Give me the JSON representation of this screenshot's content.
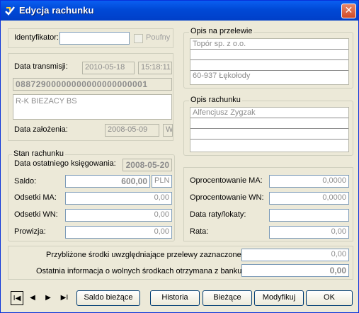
{
  "window": {
    "title": "Edycja rachunku",
    "close": "✕"
  },
  "ident": {
    "label": "Identyfikator:",
    "value": "",
    "confidential_label": "Poufny",
    "confidential_checked": false
  },
  "transmission": {
    "date_label": "Data transmisji:",
    "date": "2010-05-18",
    "time": "15:18:11",
    "account_number": "08872900000000000000000001",
    "account_name": "R-K BIEZACY  BS",
    "created_label": "Data założenia:",
    "created_date": "2008-05-09",
    "created_code": "W"
  },
  "transfer_desc": {
    "legend": "Opis na przelewie",
    "lines": [
      "Topór sp. z o.o.",
      "",
      "",
      "60-937 Łękołody"
    ]
  },
  "account_desc": {
    "legend": "Opis rachunku",
    "lines": [
      "Alfencjusz Zygzak",
      "",
      "",
      ""
    ]
  },
  "status": {
    "legend": "Stan rachunku",
    "last_posting_label": "Data ostatniego księgowania:",
    "last_posting_date": "2008-05-20",
    "balance_label": "Saldo:",
    "balance": "600,00",
    "currency": "PLN",
    "interest_ma_label": "Odsetki MA:",
    "interest_ma": "0,00",
    "interest_wn_label": "Odsetki WN:",
    "interest_wn": "0,00",
    "commission_label": "Prowizja:",
    "commission": "0,00"
  },
  "rates": {
    "rate_ma_label": "Oprocentowanie MA:",
    "rate_ma": "0,0000",
    "rate_wn_label": "Oprocentowanie WN:",
    "rate_wn": "0,0000",
    "installment_date_label": "Data raty/lokaty:",
    "installment_date": "",
    "installment_label": "Rata:",
    "installment": "0,00"
  },
  "funds": {
    "approx_label": "Przybliżone środki uwzględniające przelewy zaznaczone:",
    "approx_value": "0,00",
    "last_info_label": "Ostatnia informacja o wolnych środkach otrzymana z banku:",
    "last_info_value": "0,00"
  },
  "buttons": {
    "first": "I◀",
    "prev": "◀",
    "next": "▶",
    "last": "▶I",
    "current_balance": "Saldo bieżące",
    "history": "Historia",
    "current": "Bieżące",
    "modify": "Modyfikuj",
    "ok": "OK"
  },
  "colors": {
    "titlebar": "#0049d6",
    "window_bg": "#ece9d8",
    "close": "#d04a26"
  }
}
